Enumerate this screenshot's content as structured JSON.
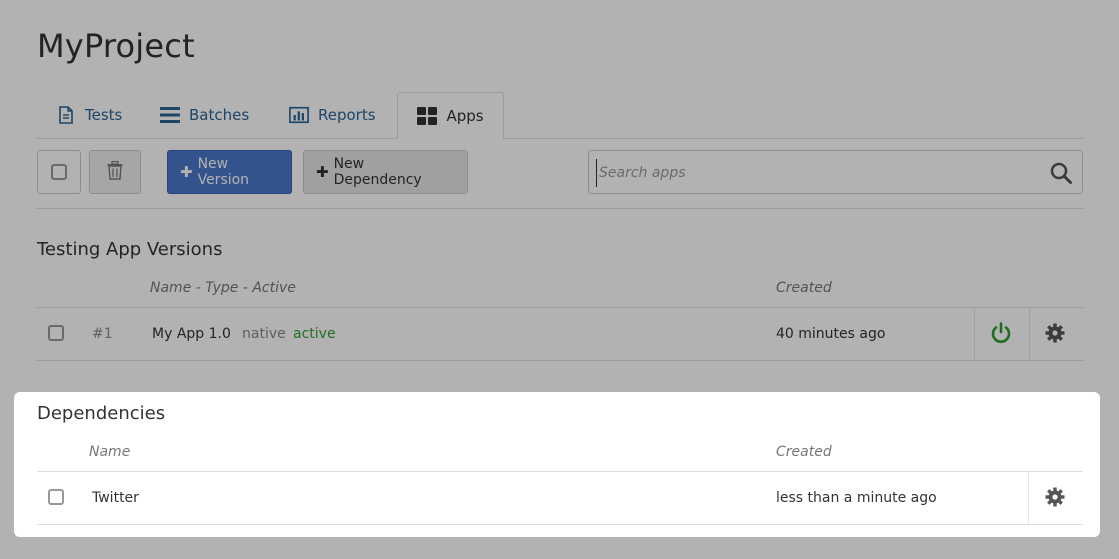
{
  "project": {
    "title": "MyProject"
  },
  "tabs": [
    {
      "label": "Tests",
      "icon": "document-icon"
    },
    {
      "label": "Batches",
      "icon": "list-icon"
    },
    {
      "label": "Reports",
      "icon": "bar-chart-icon"
    },
    {
      "label": "Apps",
      "icon": "grid-icon"
    }
  ],
  "active_tab": "Apps",
  "toolbar": {
    "new_version_label": "New Version",
    "new_dependency_label": "New Dependency",
    "search_placeholder": "Search apps"
  },
  "versions": {
    "title": "Testing App Versions",
    "col_name": "Name - Type - Active",
    "col_created": "Created",
    "rows": [
      {
        "num": "#1",
        "name": "My App 1.0",
        "type": "native",
        "status": "active",
        "created": "40 minutes ago"
      }
    ]
  },
  "dependencies": {
    "title": "Dependencies",
    "col_name": "Name",
    "col_created": "Created",
    "rows": [
      {
        "name": "Twitter",
        "created": "less than a minute ago"
      }
    ]
  },
  "colors": {
    "primary": "#4a77c9",
    "link": "#2a6496",
    "active_green": "#2e9d2e"
  }
}
